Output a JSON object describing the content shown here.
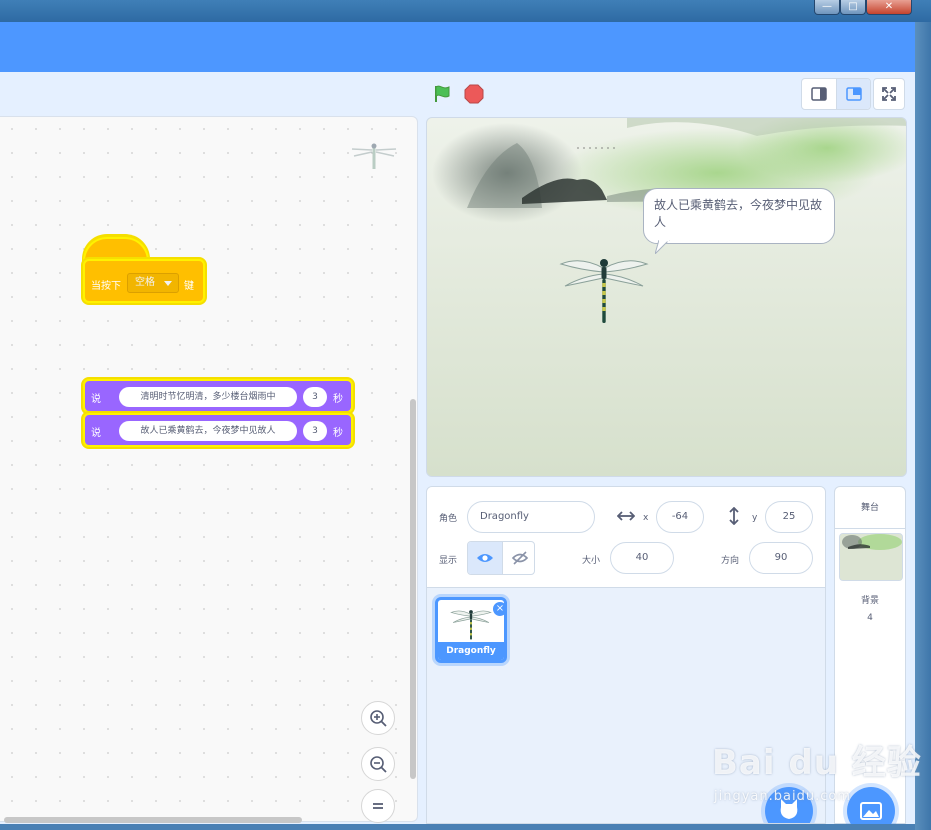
{
  "window": {
    "min": "—",
    "max": "□",
    "close": "✕"
  },
  "script": {
    "hat": {
      "when_key": "当按下",
      "key": "空格",
      "suffix": "键"
    },
    "say_blocks": [
      {
        "label": "说",
        "message": "清明时节忆明清，多少楼台烟雨中",
        "secs": "3",
        "unit": "秒"
      },
      {
        "label": "说",
        "message": "故人已乘黄鹤去，今夜梦中见故人",
        "secs": "3",
        "unit": "秒"
      }
    ]
  },
  "stage": {
    "speech": "故人已乘黄鹤去，今夜梦中见故人"
  },
  "sprite_info": {
    "sprite_label": "角色",
    "sprite_name": "Dragonfly",
    "x_label": "x",
    "x": "-64",
    "y_label": "y",
    "y": "25",
    "show_label": "显示",
    "size_label": "大小",
    "size": "40",
    "direction_label": "方向",
    "direction": "90"
  },
  "sprites": [
    {
      "name": "Dragonfly"
    }
  ],
  "stage_target": {
    "title": "舞台",
    "backdrop_label": "背景",
    "backdrop_count": "4"
  },
  "watermark": {
    "logo": "Bai du 经验",
    "url": "jingyan.baidu.com"
  },
  "colors": {
    "menu": "#4d97ff",
    "events": "#ffbf00",
    "looks": "#9966ff",
    "accent": "#4c97ff"
  }
}
